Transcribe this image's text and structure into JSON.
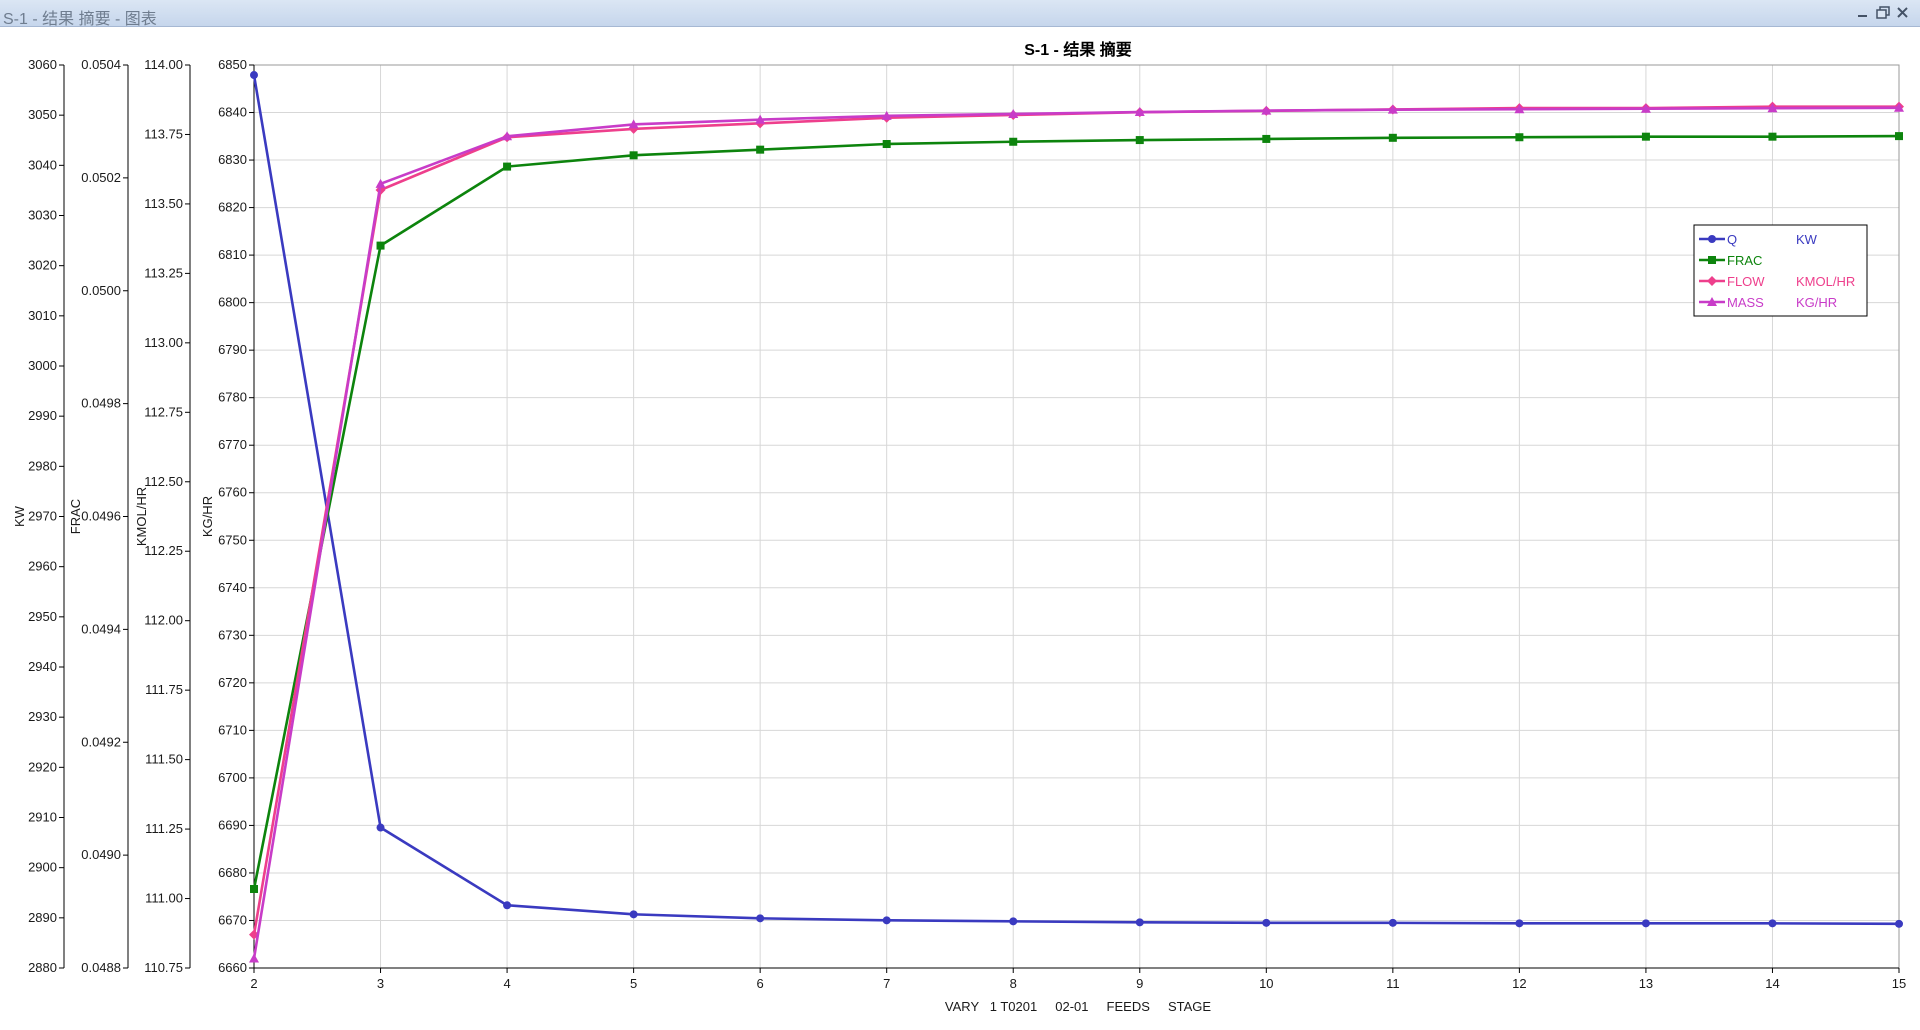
{
  "window": {
    "title": "S-1 - 结果 摘要 - 图表"
  },
  "colors": {
    "Q": "#3a3ac0",
    "FRAC": "#0d840d",
    "FLOW": "#ee3f8c",
    "MASS": "#c83cc8",
    "grid": "#d7d7d7",
    "axis": "#000000"
  },
  "chart_data": {
    "type": "line",
    "title": "S-1 - 结果 摘要",
    "xlabel": "VARY   1 T0201     02-01     FEEDS     STAGE",
    "x": [
      2,
      3,
      4,
      5,
      6,
      7,
      8,
      9,
      10,
      11,
      12,
      13,
      14,
      15
    ],
    "xlim": [
      2,
      15
    ],
    "grid": true,
    "legend_position": "top-right",
    "axes": [
      {
        "id": "KW",
        "label": "KW",
        "ylim": [
          2880,
          3060
        ],
        "ticks": [
          "2880",
          "2890",
          "2900",
          "2910",
          "2920",
          "2930",
          "2940",
          "2950",
          "2960",
          "2970",
          "2980",
          "2990",
          "3000",
          "3010",
          "3020",
          "3030",
          "3040",
          "3050",
          "3060"
        ]
      },
      {
        "id": "FRAC",
        "label": "FRAC",
        "ylim": [
          0.0488,
          0.0504
        ],
        "ticks": [
          "0.0488",
          "0.0490",
          "0.0492",
          "0.0494",
          "0.0496",
          "0.0498",
          "0.0500",
          "0.0502",
          "0.0504"
        ]
      },
      {
        "id": "KMOLHR",
        "label": "KMOL/HR",
        "ylim": [
          110.75,
          114.0
        ],
        "ticks": [
          "110.75",
          "111.00",
          "111.25",
          "111.50",
          "111.75",
          "112.00",
          "112.25",
          "112.50",
          "112.75",
          "113.00",
          "113.25",
          "113.50",
          "113.75",
          "114.00"
        ]
      },
      {
        "id": "KGHR",
        "label": "KG/HR",
        "ylim": [
          6660,
          6850
        ],
        "ticks": [
          "6660",
          "6670",
          "6680",
          "6690",
          "6700",
          "6710",
          "6720",
          "6730",
          "6740",
          "6750",
          "6760",
          "6770",
          "6780",
          "6790",
          "6800",
          "6810",
          "6820",
          "6830",
          "6840",
          "6850"
        ]
      }
    ],
    "series": [
      {
        "name": "Q",
        "unit": "KW",
        "axis": "KW",
        "marker": "circle",
        "values": [
          3058,
          2908,
          2892.5,
          2890.7,
          2889.9,
          2889.5,
          2889.3,
          2889.1,
          2889.0,
          2889.0,
          2888.9,
          2888.9,
          2888.9,
          2888.8
        ]
      },
      {
        "name": "FRAC",
        "unit": "",
        "axis": "FRAC",
        "marker": "square",
        "values": [
          0.04894,
          0.05008,
          0.05022,
          0.05024,
          0.05025,
          0.05026,
          0.050264,
          0.050267,
          0.050269,
          0.050271,
          0.050272,
          0.050273,
          0.050273,
          0.050274
        ]
      },
      {
        "name": "FLOW",
        "unit": "KMOL/HR",
        "axis": "KMOLHR",
        "marker": "diamond",
        "values": [
          110.87,
          113.55,
          113.74,
          113.77,
          113.79,
          113.81,
          113.82,
          113.83,
          113.835,
          113.84,
          113.845,
          113.845,
          113.85,
          113.85
        ]
      },
      {
        "name": "MASS",
        "unit": "KG/HR",
        "axis": "KGHR",
        "marker": "triangle",
        "values": [
          6662,
          6825,
          6835,
          6837.5,
          6838.5,
          6839.3,
          6839.7,
          6840.1,
          6840.4,
          6840.6,
          6840.7,
          6840.8,
          6840.9,
          6841.0
        ]
      }
    ]
  }
}
